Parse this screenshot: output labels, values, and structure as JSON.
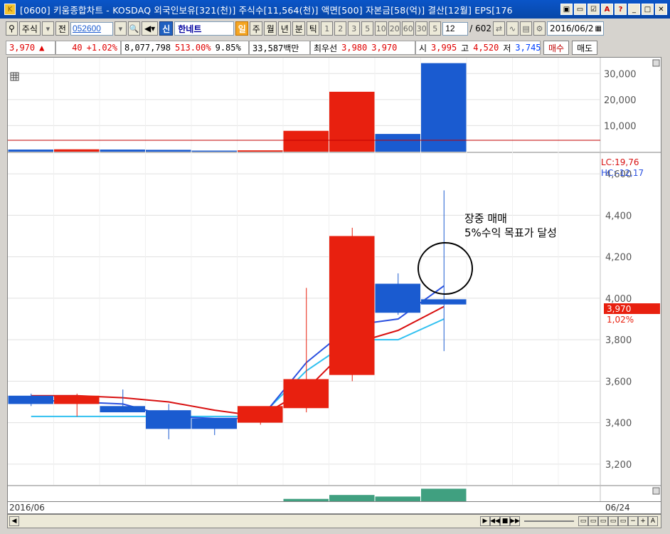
{
  "window": {
    "title": "[0600] 키움종합차트 - KOSDAQ 외국인보유[321(천)] 주식수[11,564(천)] 액면[500] 자본금[58(억)] 결산[12월] EPS[176",
    "buttons": [
      "▣",
      "▭",
      "☑",
      "A",
      "?",
      "_",
      "□",
      "✕"
    ]
  },
  "toolbar": {
    "type_label": "주식",
    "prev_label": "전",
    "code_value": "052600",
    "shin_label": "신",
    "stock_name": "한네트",
    "periods": [
      "일",
      "주",
      "월",
      "년",
      "분",
      "틱"
    ],
    "minutes": [
      "1",
      "2",
      "3",
      "5",
      "10",
      "20",
      "60",
      "30",
      "5"
    ],
    "count_value": "12",
    "count_total": "/ 602",
    "date_value": "2016/06/2"
  },
  "quote": {
    "price": "3,970",
    "arrow": "▲",
    "change": "40",
    "change_pct": "+1.02%",
    "volume": "8,077,798",
    "volume_ratio": "513.00%",
    "turnover": "9.85%",
    "amount": "33,587백만",
    "best_label": "최우선",
    "best_ask": "3,980",
    "best_bid": "3,970",
    "open_label": "시",
    "open": "3,995",
    "high_label": "고",
    "high": "4,520",
    "low_label": "저",
    "low": "3,745",
    "buy_label": "매수",
    "sell_label": "매도"
  },
  "annotation": {
    "line1": "장중 매매",
    "line2": "5%수익 목표가 달성"
  },
  "price_panel": {
    "lc_label": "LC:19,76",
    "hc_label": "HC:-12,17",
    "current_price": "3,970",
    "current_pct": "1,02%",
    "y_ticks": [
      "4,600",
      "4,400",
      "4,200",
      "4,000",
      "3,800",
      "3,600",
      "3,400",
      "3,200"
    ]
  },
  "volume_panel": {
    "y_ticks": [
      "30,000",
      "20,000",
      "10,000"
    ]
  },
  "x_axis": {
    "left_label": "2016/06",
    "right_label": "06/24"
  },
  "colors": {
    "up": "#e8200f",
    "down": "#1a5bd0",
    "ma_red": "#d81010",
    "ma_blue": "#2a50e0",
    "ma_cyan": "#30c0f0",
    "vol_teal": "#40a080"
  },
  "chart_data": {
    "type": "candlestick",
    "candles": [
      {
        "open": 3530,
        "high": 3540,
        "low": 3480,
        "close": 3490
      },
      {
        "open": 3490,
        "high": 3540,
        "low": 3430,
        "close": 3530
      },
      {
        "open": 3480,
        "high": 3560,
        "low": 3450,
        "close": 3450
      },
      {
        "open": 3460,
        "high": 3490,
        "low": 3320,
        "close": 3370
      },
      {
        "open": 3420,
        "high": 3420,
        "low": 3340,
        "close": 3370
      },
      {
        "open": 3400,
        "high": 3440,
        "low": 3390,
        "close": 3480
      },
      {
        "open": 3470,
        "high": 4050,
        "low": 3450,
        "close": 3610
      },
      {
        "open": 3630,
        "high": 4340,
        "low": 3600,
        "close": 4300
      },
      {
        "open": 4070,
        "high": 4120,
        "low": 3920,
        "close": 3930
      },
      {
        "open": 3995,
        "high": 4520,
        "low": 3745,
        "close": 3970
      }
    ],
    "ma_red": [
      3530,
      3530,
      3520,
      3500,
      3460,
      3430,
      3560,
      3780,
      3845,
      3960
    ],
    "ma_blue": [
      3510,
      3500,
      3490,
      3430,
      3420,
      3420,
      3690,
      3870,
      3900,
      4060
    ],
    "ma_cyan": [
      3430,
      3430,
      3430,
      3430,
      3430,
      3430,
      3650,
      3800,
      3800,
      3900
    ],
    "volume": [
      800,
      900,
      800,
      700,
      400,
      500,
      8000,
      23000,
      6800,
      34000
    ],
    "lower_volume": [
      0,
      0,
      0,
      0,
      0,
      0,
      15,
      40,
      30,
      80
    ],
    "price_ylim": [
      3100,
      4700
    ],
    "volume_ylim": [
      0,
      35000
    ]
  }
}
